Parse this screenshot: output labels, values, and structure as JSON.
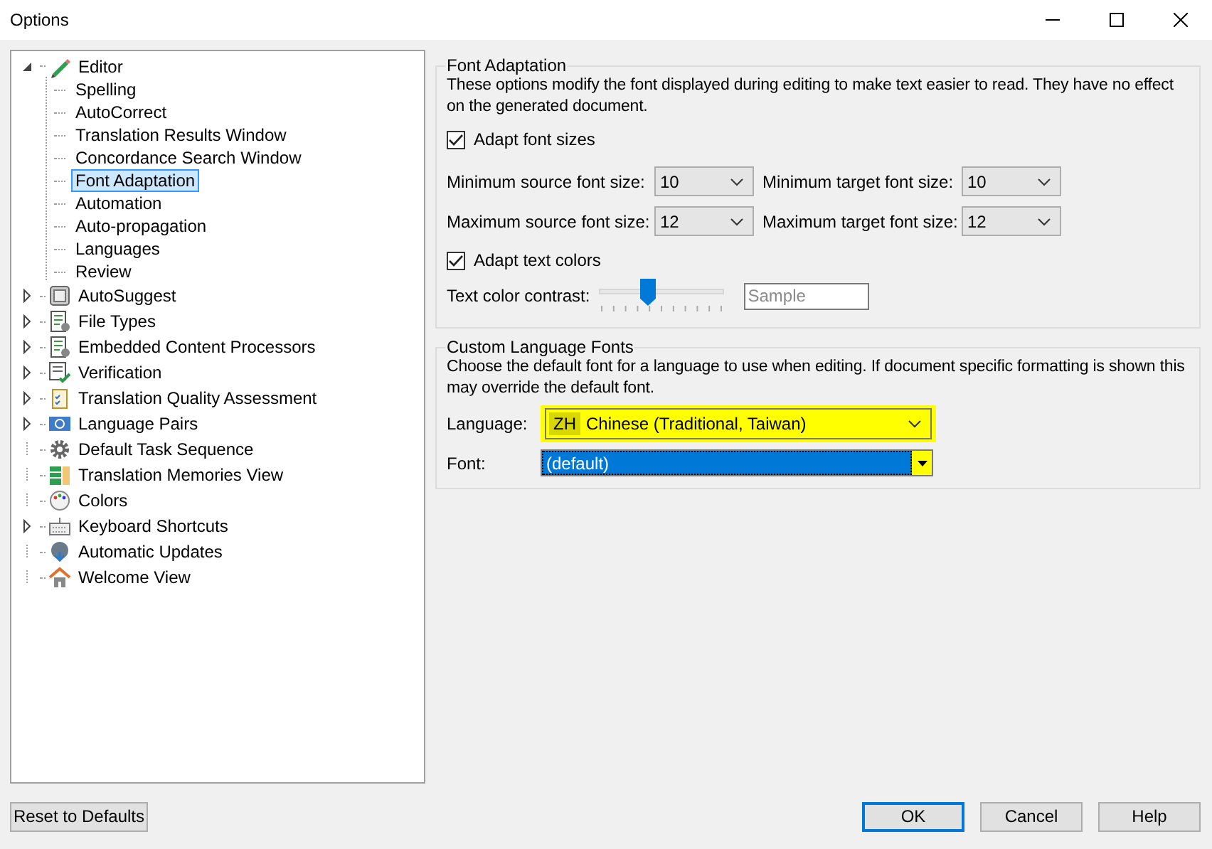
{
  "window": {
    "title": "Options"
  },
  "tree": [
    {
      "label": "Editor",
      "kind": "branch",
      "expanded": true,
      "selected": false,
      "children": [
        {
          "label": "Spelling",
          "selected": false
        },
        {
          "label": "AutoCorrect",
          "selected": false
        },
        {
          "label": "Translation Results Window",
          "selected": false
        },
        {
          "label": "Concordance Search Window",
          "selected": false
        },
        {
          "label": "Font Adaptation",
          "selected": true
        },
        {
          "label": "Automation",
          "selected": false
        },
        {
          "label": "Auto-propagation",
          "selected": false
        },
        {
          "label": "Languages",
          "selected": false
        },
        {
          "label": "Review",
          "selected": false
        }
      ]
    },
    {
      "label": "AutoSuggest",
      "kind": "branch",
      "expanded": false,
      "selected": false
    },
    {
      "label": "File Types",
      "kind": "branch",
      "expanded": false,
      "selected": false
    },
    {
      "label": "Embedded Content Processors",
      "kind": "branch",
      "expanded": false,
      "selected": false
    },
    {
      "label": "Verification",
      "kind": "branch",
      "expanded": false,
      "selected": false
    },
    {
      "label": "Translation Quality Assessment",
      "kind": "branch",
      "expanded": false,
      "selected": false
    },
    {
      "label": "Language Pairs",
      "kind": "branch",
      "expanded": false,
      "selected": false
    },
    {
      "label": "Default Task Sequence",
      "kind": "leaf",
      "selected": false
    },
    {
      "label": "Translation Memories View",
      "kind": "leaf",
      "selected": false
    },
    {
      "label": "Colors",
      "kind": "leaf",
      "selected": false
    },
    {
      "label": "Keyboard Shortcuts",
      "kind": "branch",
      "expanded": false,
      "selected": false
    },
    {
      "label": "Automatic Updates",
      "kind": "leaf",
      "selected": false
    },
    {
      "label": "Welcome View",
      "kind": "leaf",
      "selected": false
    }
  ],
  "font_adaptation": {
    "title": "Font Adaptation",
    "description": "These options modify the font displayed during editing to make text easier to read. They have no effect on the generated document.",
    "adapt_sizes": {
      "label": "Adapt font sizes",
      "checked": true
    },
    "sizes": [
      {
        "label": "Minimum source font size:",
        "value": "10"
      },
      {
        "label": "Minimum target font size:",
        "value": "10"
      },
      {
        "label": "Maximum source font size:",
        "value": "12"
      },
      {
        "label": "Maximum target font size:",
        "value": "12"
      }
    ],
    "adapt_colors": {
      "label": "Adapt text colors",
      "checked": true
    },
    "contrast": {
      "label": "Text color contrast:",
      "level": 0.39,
      "sample": "Sample"
    }
  },
  "custom_fonts": {
    "title": "Custom Language Fonts",
    "description": "Choose the default font for a language to use when editing. If document specific formatting is shown this may override the default font.",
    "language": {
      "label": "Language:",
      "code": "ZH",
      "value": "Chinese (Traditional, Taiwan)",
      "highlighted": true
    },
    "font": {
      "label": "Font:",
      "value": "(default)",
      "highlighted": true
    }
  },
  "buttons": {
    "reset": "Reset to Defaults",
    "ok": "OK",
    "cancel": "Cancel",
    "help": "Help"
  }
}
